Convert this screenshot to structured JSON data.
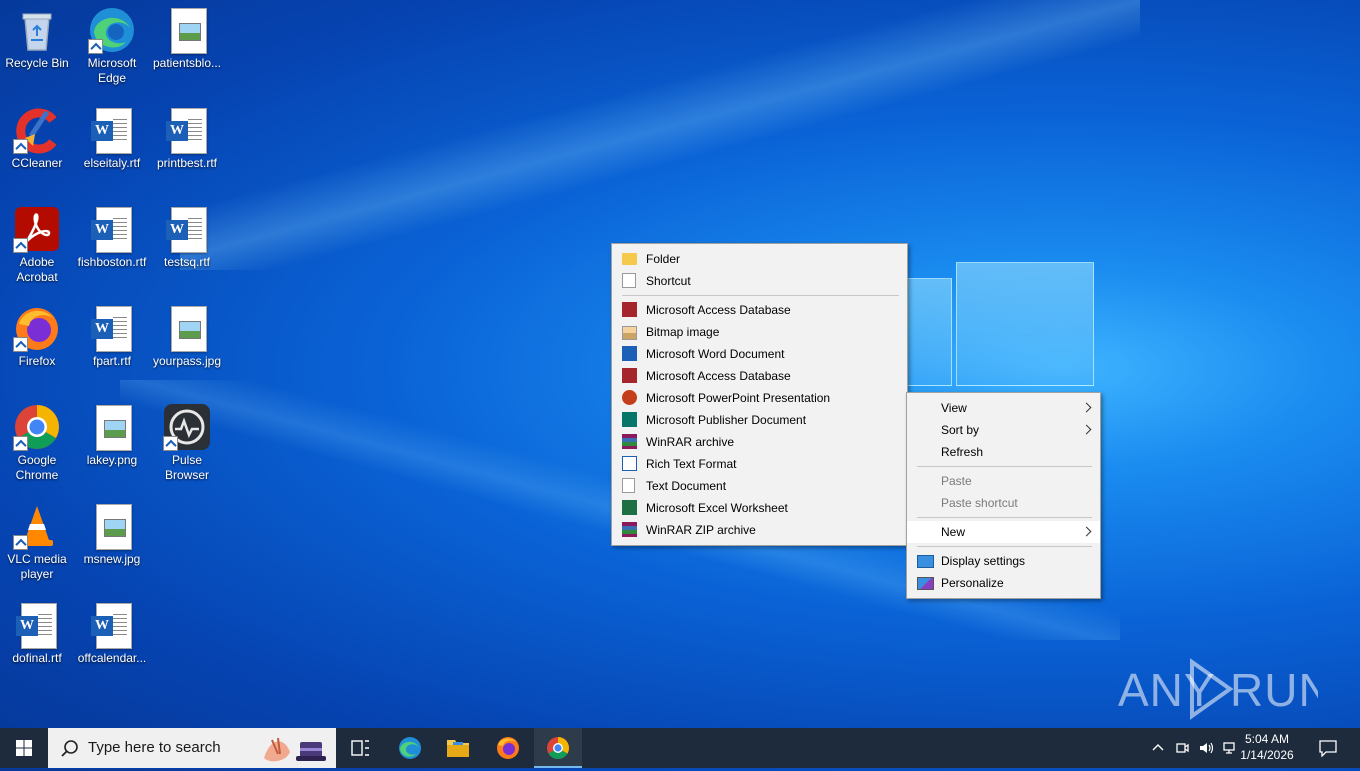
{
  "desktop": {
    "icons": [
      {
        "label": "Recycle Bin",
        "icon": "recycle-bin-icon"
      },
      {
        "label": "Microsoft Edge",
        "icon": "edge-icon"
      },
      {
        "label": "patientsblo...",
        "icon": "image-file-icon"
      },
      {
        "label": "CCleaner",
        "icon": "ccleaner-icon"
      },
      {
        "label": "elseitaly.rtf",
        "icon": "word-rtf-icon"
      },
      {
        "label": "printbest.rtf",
        "icon": "word-rtf-icon"
      },
      {
        "label": "Adobe Acrobat",
        "icon": "acrobat-icon"
      },
      {
        "label": "fishboston.rtf",
        "icon": "word-rtf-icon"
      },
      {
        "label": "testsq.rtf",
        "icon": "word-rtf-icon"
      },
      {
        "label": "Firefox",
        "icon": "firefox-icon"
      },
      {
        "label": "fpart.rtf",
        "icon": "word-rtf-icon"
      },
      {
        "label": "yourpass.jpg",
        "icon": "image-file-icon"
      },
      {
        "label": "Google Chrome",
        "icon": "chrome-icon"
      },
      {
        "label": "lakey.png",
        "icon": "image-file-icon"
      },
      {
        "label": "Pulse Browser",
        "icon": "pulse-browser-icon"
      },
      {
        "label": "VLC media player",
        "icon": "vlc-icon"
      },
      {
        "label": "msnew.jpg",
        "icon": "image-file-icon"
      },
      {
        "label": "dofinal.rtf",
        "icon": "word-rtf-icon"
      },
      {
        "label": "offcalendar...",
        "icon": "word-rtf-icon"
      }
    ]
  },
  "context_menu": {
    "view": "View",
    "sort_by": "Sort by",
    "refresh": "Refresh",
    "paste": "Paste",
    "paste_shortcut": "Paste shortcut",
    "new": "New",
    "display_settings": "Display settings",
    "personalize": "Personalize"
  },
  "new_submenu": {
    "folder": "Folder",
    "shortcut": "Shortcut",
    "items": [
      {
        "label": "Microsoft Access Database",
        "icon": "access-icon"
      },
      {
        "label": "Bitmap image",
        "icon": "bitmap-icon"
      },
      {
        "label": "Microsoft Word Document",
        "icon": "word-icon"
      },
      {
        "label": "Microsoft Access Database",
        "icon": "access-icon"
      },
      {
        "label": "Microsoft PowerPoint Presentation",
        "icon": "powerpoint-icon"
      },
      {
        "label": "Microsoft Publisher Document",
        "icon": "publisher-icon"
      },
      {
        "label": "WinRAR archive",
        "icon": "winrar-icon"
      },
      {
        "label": "Rich Text Format",
        "icon": "rtf-icon"
      },
      {
        "label": "Text Document",
        "icon": "text-doc-icon"
      },
      {
        "label": "Microsoft Excel Worksheet",
        "icon": "excel-icon"
      },
      {
        "label": "WinRAR ZIP archive",
        "icon": "winrar-zip-icon"
      }
    ]
  },
  "taskbar": {
    "search_placeholder": "Type here to search",
    "time": "5:04 AM",
    "date": "1/14/2026"
  },
  "watermark": "ANY RUN"
}
